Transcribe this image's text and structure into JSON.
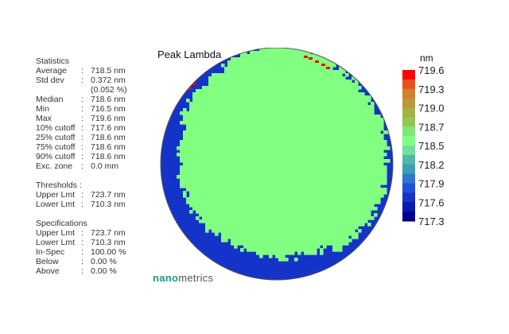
{
  "statistics": {
    "title": "Statistics",
    "rows": [
      {
        "label": "Average",
        "sep": ":",
        "value": "718.5 nm"
      },
      {
        "label": "Std dev",
        "sep": ":",
        "value": "0.372 nm"
      },
      {
        "label": "",
        "sep": "",
        "value": "(0.052 %)"
      },
      {
        "label": "Median",
        "sep": ":",
        "value": "718.6 nm"
      },
      {
        "label": "Min",
        "sep": ":",
        "value": "716.5 nm"
      },
      {
        "label": "Max",
        "sep": ":",
        "value": "719.6 nm"
      },
      {
        "label": "10% cutoff",
        "sep": ":",
        "value": "717.6 nm"
      },
      {
        "label": "25% cutoff",
        "sep": ":",
        "value": "718.6 nm"
      },
      {
        "label": "75% cutoff",
        "sep": ":",
        "value": "718.6 nm"
      },
      {
        "label": "90% cutoff",
        "sep": ":",
        "value": "718.6 nm"
      },
      {
        "label": "Exc. zone",
        "sep": ":",
        "value": "0.0 mm"
      }
    ]
  },
  "thresholds": {
    "title": "Thresholds :",
    "rows": [
      {
        "label": "Upper Lmt",
        "sep": ":",
        "value": "723.7 nm"
      },
      {
        "label": "Lower Lmt",
        "sep": ":",
        "value": "710.3 nm"
      }
    ]
  },
  "specifications": {
    "title": "Specifications",
    "rows": [
      {
        "label": "Upper Lmt",
        "sep": ":",
        "value": "723.7 nm"
      },
      {
        "label": "Lower Lmt",
        "sep": ":",
        "value": "710.3 nm"
      },
      {
        "label": "In-Spec",
        "sep": ":",
        "value": "100.00 %"
      },
      {
        "label": "Below",
        "sep": ":",
        "value": "0.00 %"
      },
      {
        "label": "Above",
        "sep": ":",
        "value": "0.00 %"
      }
    ]
  },
  "brand": {
    "part1": "nano",
    "part2": "metrics"
  },
  "chart_data": {
    "type": "heatmap",
    "title": "Peak Lambda",
    "colorbar_unit": "nm",
    "colorbar_ticks": [
      "719.6",
      "719.3",
      "719.0",
      "718.7",
      "718.5",
      "718.2",
      "717.9",
      "717.6",
      "717.3"
    ],
    "colorbar_range": [
      717.3,
      719.6
    ],
    "colorbar_colors": [
      "#ff0000",
      "#e8501e",
      "#d2802c",
      "#b89a3a",
      "#a8b040",
      "#90c850",
      "#80e878",
      "#80ff80",
      "#70e09a",
      "#50b8a8",
      "#3aa0b8",
      "#2a78d0",
      "#1e50d8",
      "#1433c8",
      "#0a1ab0",
      "#000090"
    ],
    "wafer": {
      "center_fill": "#80ff80",
      "edge_fill": "#1433c8",
      "hot_fill": "#ff0000",
      "border_color": "#555555",
      "center_value": 718.6,
      "edge_value": 717.4,
      "max_value": 719.6
    }
  }
}
